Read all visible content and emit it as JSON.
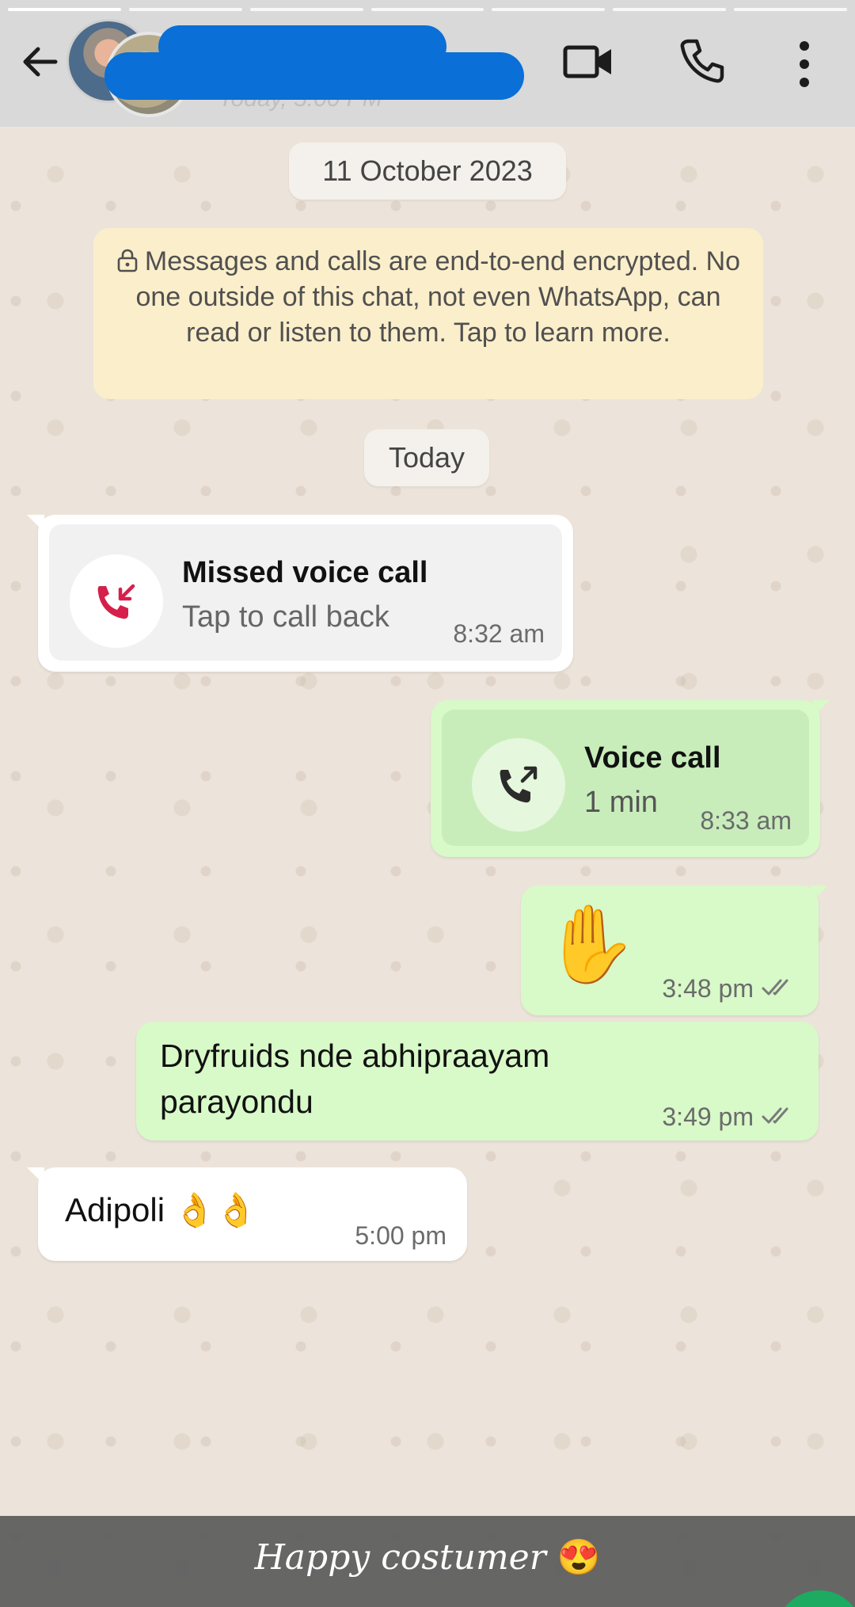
{
  "header": {
    "last_seen": "Today, 5:00 PM",
    "icons": {
      "back": "back-arrow-icon",
      "video": "video-call-icon",
      "voice": "voice-call-icon",
      "menu": "more-vert-icon"
    }
  },
  "chat": {
    "date_chip": "11 October 2023",
    "encryption_notice": "Messages and calls are end-to-end encrypted. No one outside of this chat, not even WhatsApp, can read or listen to them. Tap to learn more.",
    "today_chip": "Today",
    "messages": [
      {
        "type": "call-incoming",
        "title": "Missed voice call",
        "subtitle": "Tap to call back",
        "time": "8:32 am"
      },
      {
        "type": "call-outgoing",
        "title": "Voice call",
        "subtitle": "1 min",
        "time": "8:33 am"
      },
      {
        "type": "text-outgoing",
        "text": "✋",
        "time": "3:48 pm",
        "status": "read"
      },
      {
        "type": "text-outgoing",
        "text": "Dryfruids nde abhipraayam parayondu",
        "time": "3:49 pm",
        "status": "read"
      },
      {
        "type": "text-incoming",
        "text": "Adipoli 👌👌",
        "time": "5:00 pm"
      }
    ]
  },
  "caption": {
    "text": "Happy costumer",
    "emoji": "😍"
  },
  "colors": {
    "header_bg": "#d9d9d9",
    "outgoing_bubble": "#d8f9c8",
    "incoming_bubble": "#ffffff",
    "encryption_bg": "#fbeeca",
    "missed_call_red": "#d4204b",
    "redaction_blue": "#0a6fd6",
    "caption_bar": "#5f5f5f"
  }
}
